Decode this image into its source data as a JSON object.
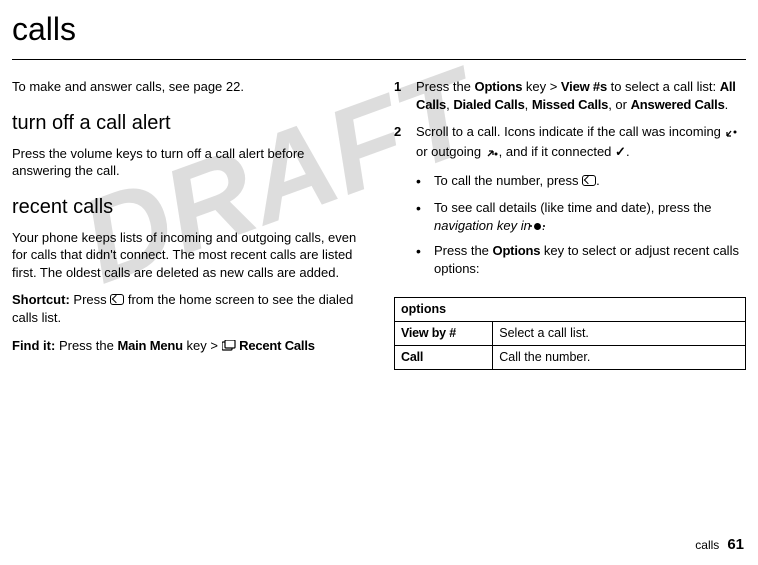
{
  "watermark": "DRAFT",
  "page_title": "calls",
  "left": {
    "p1": "To make and answer calls, see page 22.",
    "h_turnoff": "turn off a call alert",
    "p_turnoff": "Press the volume keys to turn off a call alert before answering the call.",
    "h_recent": "recent calls",
    "p_recent1": "Your phone keeps lists of incoming and outgoing calls, even for calls that didn't connect. The most recent calls are listed first. The oldest calls are deleted as new calls are added.",
    "shortcut_label": "Shortcut:",
    "shortcut_text_a": "Press ",
    "shortcut_text_b": " from the home screen to see the dialed calls list.",
    "findit_label": "Find it:",
    "findit_a": "Press the ",
    "findit_key": "Main Menu",
    "findit_b": " key > ",
    "findit_item": "Recent Calls"
  },
  "right": {
    "step1_a": "Press the ",
    "step1_key": "Options",
    "step1_b": " key > ",
    "step1_view": "View #s",
    "step1_c": " to select a call list: ",
    "list1": "All Calls",
    "list2": "Dialed Calls",
    "list3": "Missed Calls",
    "list_or": ", or ",
    "list4": "Answered Calls",
    "step2_a": "Scroll to a call. Icons indicate if the call was incoming ",
    "step2_b": " or outgoing ",
    "step2_c": ", and if it connected ",
    "step2_d": ".",
    "b1_a": "To call the number, press ",
    "b1_b": ".",
    "b2_a": "To see call details (like time and date), press the ",
    "b2_nav": "navigation key in",
    "b2_b": ".",
    "b3_a": "Press the ",
    "b3_key": "Options",
    "b3_b": " key to select or adjust recent calls options:"
  },
  "table": {
    "header": "options",
    "rows": [
      {
        "label": "View by #",
        "desc": "Select a call list."
      },
      {
        "label": "Call",
        "desc": "Call the number."
      }
    ]
  },
  "footer": {
    "section": "calls",
    "page": "61"
  }
}
